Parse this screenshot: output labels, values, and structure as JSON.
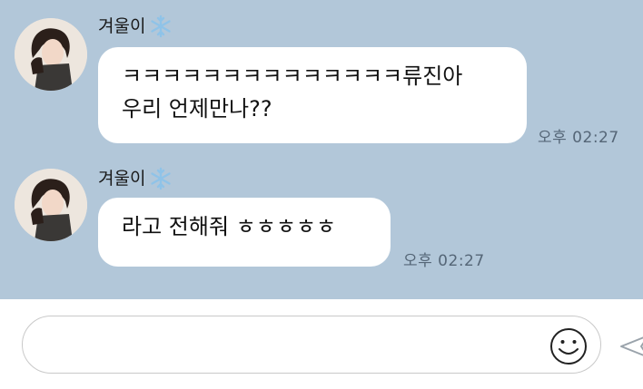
{
  "messages": [
    {
      "sender": "겨울이",
      "lines": [
        "ㅋㅋㅋㅋㅋㅋㅋㅋㅋㅋㅋㅋㅋㅋ류진아",
        "우리 언제만나??"
      ],
      "time": "오후 02:27"
    },
    {
      "sender": "겨울이",
      "lines": [
        "라고 전해줘 ㅎㅎㅎㅎㅎ"
      ],
      "time": "오후 02:27"
    }
  ],
  "input": {
    "value": "",
    "placeholder": ""
  },
  "icons": {
    "sender_badge": "snowflake-icon",
    "emoji": "smiley-icon",
    "send": "send-icon"
  },
  "colors": {
    "chat_background": "#b2c7d9",
    "bubble": "#ffffff",
    "input_background": "#ffffff"
  }
}
